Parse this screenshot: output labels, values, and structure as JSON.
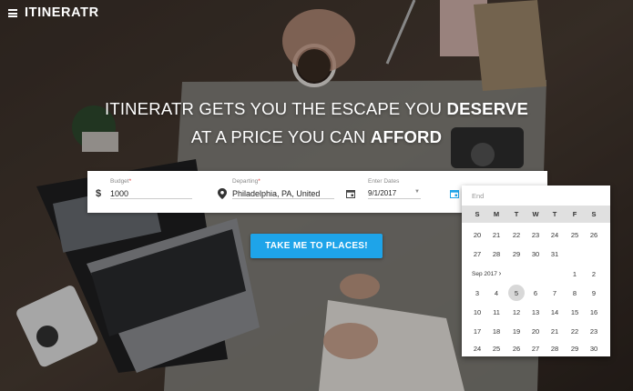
{
  "app": {
    "logo": "ITINERATR"
  },
  "headline": {
    "line1_prefix": "ITINERATR GETS YOU THE ESCAPE YOU ",
    "line1_bold": "DESERVE",
    "line2_prefix": "AT A PRICE YOU CAN ",
    "line2_bold": "AFFORD"
  },
  "search": {
    "budget": {
      "label": "Budget",
      "required": "*",
      "currency": "$",
      "value": "1000"
    },
    "departing": {
      "label": "Departing",
      "required": "*",
      "value": "Philadelphia, PA, United"
    },
    "dates": {
      "label": "Enter Dates",
      "value": "9/1/2017"
    }
  },
  "cta": {
    "label": "TAKE ME TO PLACES!"
  },
  "datepicker": {
    "end_label": "End",
    "weekdays": [
      "S",
      "M",
      "T",
      "W",
      "T",
      "F",
      "S"
    ],
    "prev_rows": [
      [
        "20",
        "21",
        "22",
        "23",
        "24",
        "25",
        "26"
      ],
      [
        "27",
        "28",
        "29",
        "30",
        "31",
        "",
        ""
      ]
    ],
    "month_label": "Sep 2017",
    "month_rows": [
      [
        "",
        "",
        "",
        "",
        "",
        "1",
        "2"
      ],
      [
        "3",
        "4",
        "5",
        "6",
        "7",
        "8",
        "9"
      ],
      [
        "10",
        "11",
        "12",
        "13",
        "14",
        "15",
        "16"
      ],
      [
        "17",
        "18",
        "19",
        "20",
        "21",
        "22",
        "23"
      ],
      [
        "24",
        "25",
        "26",
        "27",
        "28",
        "29",
        "30"
      ]
    ],
    "highlighted_day": "5"
  },
  "colors": {
    "accent": "#1ea4e9",
    "required": "#e53935"
  }
}
